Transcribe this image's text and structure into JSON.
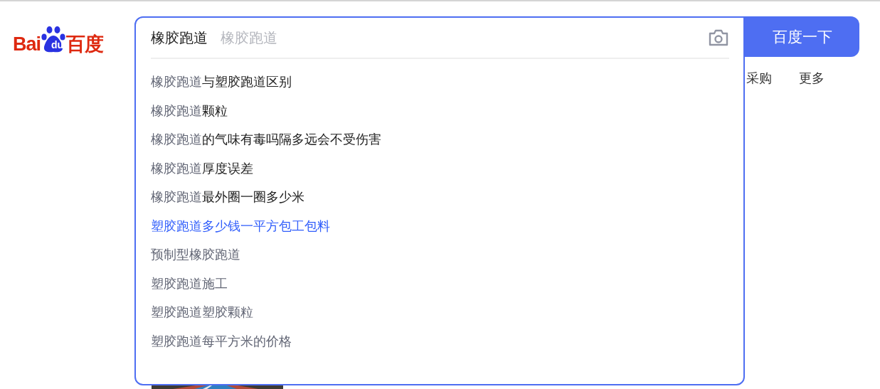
{
  "logo": {
    "left": "Bai",
    "paw": "du",
    "right": "百度"
  },
  "search": {
    "value": "橡胶跑道",
    "placeholder": "橡胶跑道"
  },
  "search_button": "百度一下",
  "nav": [
    "采购",
    "更多"
  ],
  "suggestions": [
    {
      "match": "橡胶跑道",
      "rest": "与塑胶跑道区别",
      "selected": false
    },
    {
      "match": "橡胶跑道",
      "rest": "颗粒",
      "selected": false
    },
    {
      "match": "橡胶跑道",
      "rest": "的气味有毒吗隔多远会不受伤害",
      "selected": false
    },
    {
      "match": "橡胶跑道",
      "rest": "厚度误差",
      "selected": false
    },
    {
      "match": "橡胶跑道",
      "rest": "最外圈一圈多少米",
      "selected": false
    },
    {
      "match": "塑胶跑道多少钱一平方包工包料",
      "selected": true
    },
    {
      "match": "预制型橡胶跑道",
      "selected": false
    },
    {
      "match": "塑胶跑道施工",
      "selected": false
    },
    {
      "match": "塑胶跑道塑胶颗粒",
      "selected": false
    },
    {
      "match": "塑胶跑道每平方米的价格",
      "selected": false
    }
  ]
}
